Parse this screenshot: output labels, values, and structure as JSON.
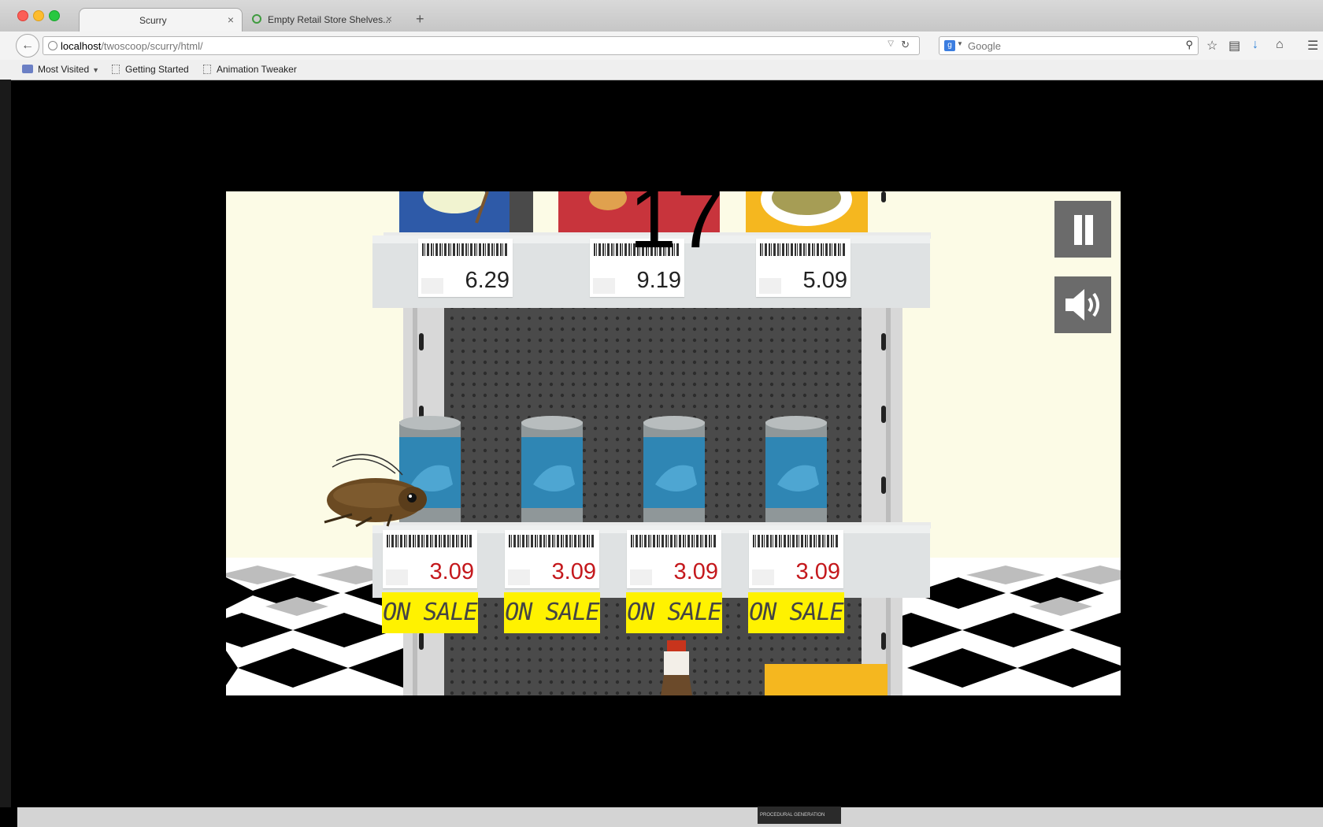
{
  "browser": {
    "tabs": [
      {
        "title": "Scurry",
        "active": true
      },
      {
        "title": "Empty Retail Store Shelves...",
        "active": false
      }
    ],
    "url_host": "localhost",
    "url_path": "/twoscoop/scurry/html/",
    "search_placeholder": "Google",
    "bookmarks": [
      "Most Visited",
      "Getting Started",
      "Animation Tweaker"
    ]
  },
  "game": {
    "score": "17",
    "top_shelf_prices": [
      "6.29",
      "9.19",
      "5.09"
    ],
    "middle_shelf_prices": [
      "3.09",
      "3.09",
      "3.09",
      "3.09"
    ],
    "sale_label": "ON SALE",
    "colors": {
      "sale_price": "#c4181c",
      "sale_banner": "#fff200",
      "wall": "#fcfbe6",
      "button": "#6b6b6b"
    }
  },
  "taskbar": {
    "thumbnail_text": "PROCEDURAL GENERATION"
  }
}
